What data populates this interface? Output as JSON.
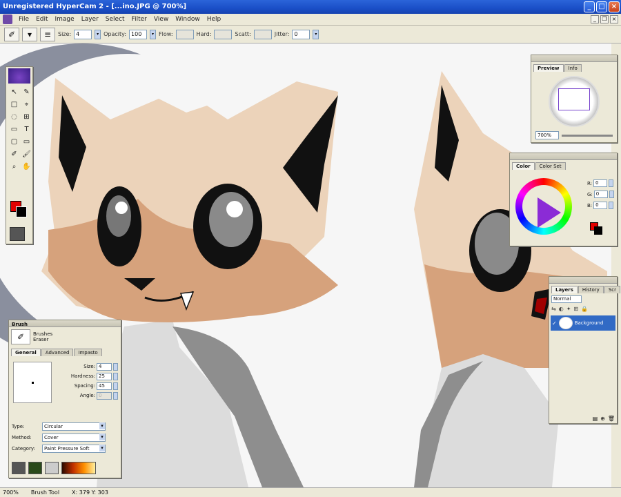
{
  "window": {
    "title": "Unregistered HyperCam 2 - [...ino.JPG @ 700%]",
    "buttons": {
      "minimize": "_",
      "maximize": "□",
      "close": "×"
    }
  },
  "menu": {
    "items": [
      "File",
      "Edit",
      "Image",
      "Layer",
      "Select",
      "Filter",
      "View",
      "Window",
      "Help"
    ],
    "mdi": {
      "minimize": "_",
      "restore": "❐",
      "close": "×"
    }
  },
  "options": {
    "size_label": "Size:",
    "size_value": "4",
    "opacity_label": "Opacity:",
    "opacity_value": "100",
    "jitter_label": "Jitter:",
    "jitter_value": "0",
    "dim1_label": "Flow:",
    "dim1_value": "",
    "dim2_label": "Hard:",
    "dim2_value": "",
    "dim3_label": "Scatt:",
    "dim3_value": ""
  },
  "toolbox": {
    "tools": [
      "↖",
      "✎",
      "□",
      "⌖",
      "◌",
      "⊞",
      "▭",
      "T",
      "▢",
      "▭",
      "✐",
      "🖌",
      "⌕",
      "✋"
    ]
  },
  "preview": {
    "tabs": [
      "Preview",
      "Info"
    ],
    "zoom": "700%"
  },
  "color": {
    "tabs": [
      "Color",
      "Color Set"
    ],
    "rgb": [
      {
        "label": "R:",
        "value": "0"
      },
      {
        "label": "G:",
        "value": "0"
      },
      {
        "label": "B:",
        "value": "0"
      }
    ],
    "fg": "#e20000",
    "bg": "#000000"
  },
  "layers": {
    "tabs": [
      "Layers",
      "History",
      "Scr"
    ],
    "mode": "Normal",
    "icons": [
      "⇆",
      "◐",
      "✦",
      "⊞",
      "🔒"
    ],
    "items": [
      {
        "name": "Background",
        "visible": "✓"
      }
    ],
    "footer": [
      "▤",
      "⊕",
      "🗑"
    ]
  },
  "brush": {
    "title": "Brush",
    "tool_names": [
      "Brushes",
      "Eraser"
    ],
    "tabs": [
      "General",
      "Advanced",
      "Impasto"
    ],
    "settings": [
      {
        "label": "Size:",
        "value": "4"
      },
      {
        "label": "Hardness:",
        "value": "25"
      },
      {
        "label": "Spacing:",
        "value": "45"
      },
      {
        "label": "Angle:",
        "value": "0"
      }
    ],
    "props": [
      {
        "label": "Type:",
        "value": "Circular"
      },
      {
        "label": "Method:",
        "value": "Cover"
      },
      {
        "label": "Category:",
        "value": "Paint Pressure Soft"
      }
    ]
  },
  "status": {
    "zoom": "700%",
    "info": "Brush Tool",
    "coords": "X: 379 Y: 303"
  },
  "colors": {
    "titlebar": "#1a4fc7",
    "panel_bg": "#ece9d8",
    "fur_light": "#ecd3ba",
    "fur_mid": "#d6a27c",
    "grey_fur": "#8e8e8e",
    "selection": "#316ac5"
  }
}
